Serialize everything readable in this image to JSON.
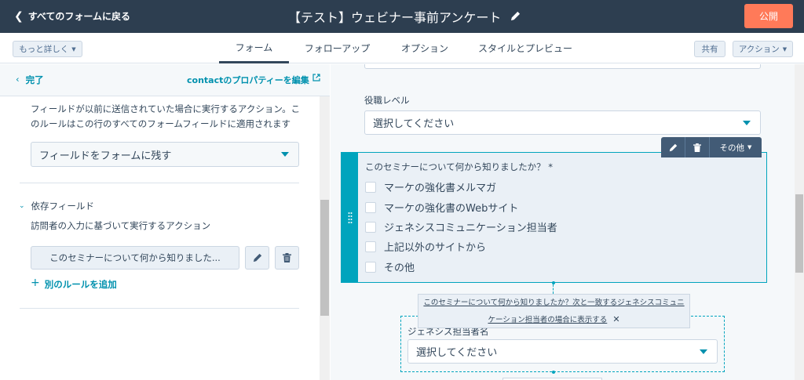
{
  "header": {
    "back_label": "すべてのフォームに戻る",
    "title": "【テスト】ウェビナー事前アンケート",
    "publish_label": "公開"
  },
  "subnav": {
    "more_details_label": "もっと詳しく",
    "tabs": [
      {
        "label": "フォーム",
        "active": true
      },
      {
        "label": "フォローアップ",
        "active": false
      },
      {
        "label": "オプション",
        "active": false
      },
      {
        "label": "スタイルとプレビュー",
        "active": false
      }
    ],
    "share_label": "共有",
    "actions_label": "アクション"
  },
  "left_panel": {
    "done_label": "完了",
    "edit_properties_label": "contactのプロパティーを編集",
    "description": "フィールドが以前に送信されていた場合に実行するアクション。このルールはこの行のすべてのフォームフィールドに適用されます",
    "field_action_value": "フィールドをフォームに残す",
    "dependent_title": "依存フィールド",
    "dependent_desc": "訪問者の入力に基づいて実行するアクション",
    "rule_label": "このセミナーについて何から知りました...",
    "add_rule_label": "別のルールを追加"
  },
  "preview": {
    "job_level_label": "役職レベル",
    "job_level_placeholder": "選択してください",
    "question_label": "このセミナーについて何から知りましたか？ *",
    "options": [
      "マーケの強化書メルマガ",
      "マーケの強化書のWebサイト",
      "ジェネシスコミュニケーション担当者",
      "上記以外のサイトから",
      "その他"
    ],
    "toolbar_other_label": "その他",
    "dependency_tooltip_line1": "このセミナーについて何から知りましたか？次と一致するジェネシスコミュニ",
    "dependency_tooltip_line2": "ケーション担当者の場合に表示する",
    "dependent_field_label": "ジェネシス担当者名",
    "dependent_field_placeholder": "選択してください"
  },
  "colors": {
    "topbar": "#2d3e50",
    "publish": "#ff7a59",
    "accent": "#00a4bd",
    "link": "#0091ae"
  }
}
